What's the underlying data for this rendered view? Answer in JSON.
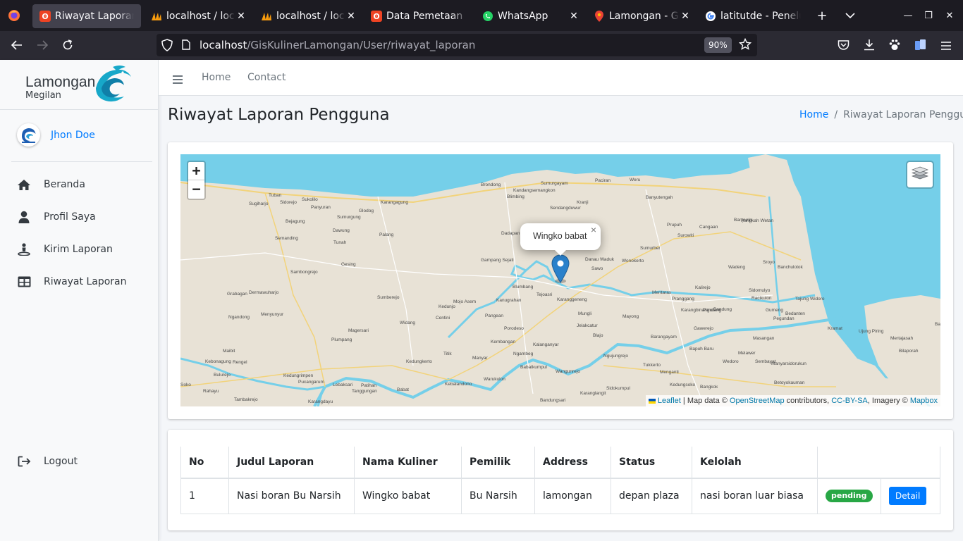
{
  "browser": {
    "tabs": [
      {
        "title": "Riwayat Laporan Pengguna",
        "icon": "codeigniter-icon",
        "active": true
      },
      {
        "title": "localhost / localhost",
        "icon": "phpmyadmin-icon"
      },
      {
        "title": "localhost / localhost",
        "icon": "phpmyadmin-icon"
      },
      {
        "title": "Data Pemetaan",
        "icon": "codeigniter-icon"
      },
      {
        "title": "WhatsApp",
        "icon": "whatsapp-icon"
      },
      {
        "title": "Lamongan - Google Maps",
        "icon": "map-pin-icon"
      },
      {
        "title": "latitutde - Penelusuran Google",
        "icon": "google-icon"
      }
    ],
    "url_host": "localhost",
    "url_path": "/GisKulinerLamongan/User/riwayat_laporan",
    "zoom": "90%"
  },
  "sidebar": {
    "brand_name": "Lamongan",
    "brand_sub": "Megilan",
    "user_name": "Jhon Doe",
    "items": [
      {
        "label": "Beranda",
        "icon": "home-icon"
      },
      {
        "label": "Profil Saya",
        "icon": "user-icon"
      },
      {
        "label": "Kirim Laporan",
        "icon": "person-send-icon"
      },
      {
        "label": "Riwayat Laporan",
        "icon": "table-icon"
      }
    ],
    "logout": "Logout"
  },
  "topnav": {
    "links": [
      "Home",
      "Contact"
    ]
  },
  "page": {
    "title": "Riwayat Laporan Pengguna",
    "breadcrumb": [
      "Home",
      "Riwayat Laporan Pengguna"
    ]
  },
  "map": {
    "zoom_in": "+",
    "zoom_out": "−",
    "popup_text": "Wingko babat",
    "popup_close": "×",
    "attribution": {
      "leaflet": "Leaflet",
      "text1": " | Map data © ",
      "osm": "OpenStreetMap",
      "text2": " contributors, ",
      "license": "CC-BY-SA",
      "text3": ", Imagery © ",
      "mapbox": "Mapbox"
    },
    "place_labels": [
      "Tuban",
      "Sukolilo",
      "Sidorejo",
      "Sugiharjo",
      "Panyuran",
      "Semanding",
      "Bejagung",
      "Dawung",
      "Tunah",
      "Sumurgung",
      "Glodog",
      "Karangagung",
      "Palang",
      "Gesing",
      "Sambongrejo",
      "Grabagan",
      "Dermawuharjo",
      "Menyunyur",
      "Ngandong",
      "Sumberejo",
      "Widang",
      "Magersari",
      "Plumpang",
      "Maibit",
      "Kebonagung",
      "Rengel",
      "Bulurejo",
      "Soko",
      "Rahayu",
      "Tambakrejo",
      "Kedungrimpen",
      "Pucangarum",
      "Karangdayu",
      "Lebaksari",
      "Patihan",
      "Tanggungan",
      "Babat",
      "Kebalandono",
      "Warukulon",
      "Kedungkerto",
      "Titik",
      "Manyar",
      "Porodeso",
      "Kembangan",
      "Ngambeg",
      "Babatkumpul",
      "Wangunrejo",
      "Karanglangit",
      "Sidokumpul",
      "Bandungsari",
      "Kedunjo",
      "Centini",
      "Mojo Asem",
      "Kanugrahan",
      "Pangean",
      "Blumbang",
      "Tejoasri",
      "Karanggeneng",
      "Gampang Sejati",
      "Dadapan",
      "Brondong",
      "Kandangsemangkon",
      "Sumurgayam",
      "Blimbing",
      "Sendangduwur",
      "Kranji",
      "Paciran",
      "Weru",
      "Banyutengah",
      "Sumurber",
      "Danau Waduk",
      "Sawo",
      "Wonokerto",
      "Mentaras",
      "Mungli",
      "Jelakcatur",
      "Blajo",
      "Mayong",
      "Kalanganyar",
      "Ngujungrejo",
      "Tukkerto",
      "Menganti",
      "Bangkok",
      "Kedungsoko",
      "Barangayam",
      "Bapuh Baru",
      "Gawerejo",
      "Karangbinangun",
      "Pandang",
      "Bandung",
      "Pranggang",
      "Kalirejo",
      "Wadeng",
      "Surowiti",
      "Prupuh",
      "Cangaan",
      "Banyurip",
      "Pangkah Wetan",
      "Sroyo",
      "Banchulotok",
      "Sidomulyo",
      "Racikulon",
      "Gumeng",
      "Pegundan",
      "Bedanten",
      "Tajung Widoro",
      "Masangan",
      "Wedoro",
      "Sembayat",
      "Manyarsidorukun",
      "Betoyokauman",
      "Melawer",
      "Kramat",
      "Bangkalan",
      "Ujung Piring",
      "Mertajasah",
      "Bilaporah"
    ]
  },
  "table": {
    "headers": [
      "No",
      "Judul Laporan",
      "Nama Kuliner",
      "Pemilik",
      "Address",
      "Status",
      "Kelolah",
      ""
    ],
    "rows": [
      {
        "no": "1",
        "judul": "Nasi boran Bu Narsih",
        "nama": "Wingko babat",
        "pemilik": "Bu Narsih",
        "address": "lamongan",
        "status": "depan plaza",
        "kelolah": "nasi boran luar biasa",
        "badge": "pending",
        "action": "Detail"
      }
    ]
  },
  "colors": {
    "accent": "#007bff",
    "badge_green": "#28a745",
    "sea": "#6bcce8",
    "land": "#e8e2d6",
    "marker": "#2a81cb"
  }
}
